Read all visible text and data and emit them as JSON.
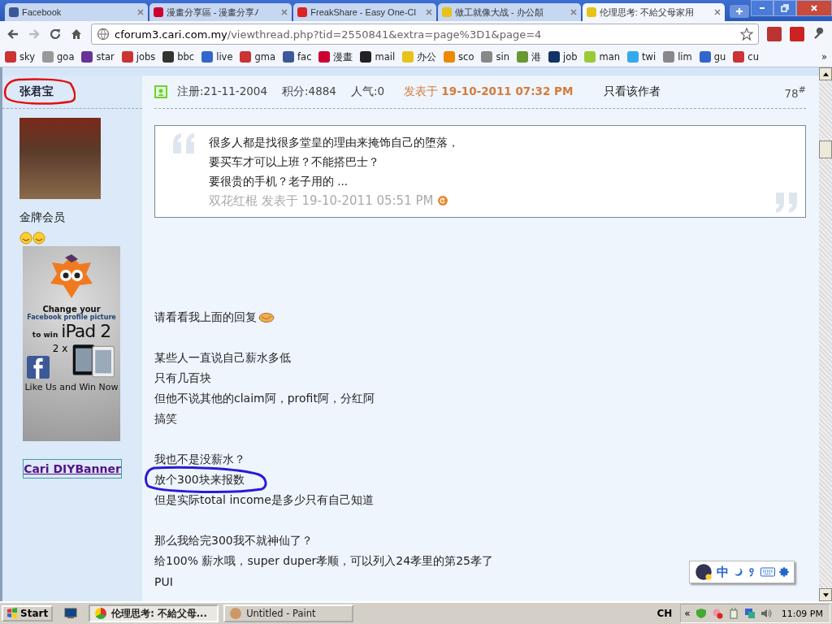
{
  "tabs": [
    {
      "title": "Facebook",
      "selected": false
    },
    {
      "title": "漫畫分享區 - 漫畫分享ﾉ",
      "selected": false
    },
    {
      "title": "FreakShare - Easy One-Cl",
      "selected": false
    },
    {
      "title": "做工就像大战 - 办公顛",
      "selected": false
    },
    {
      "title": "伦理思考: 不給父母家用",
      "selected": true
    }
  ],
  "address": {
    "host": "cforum3.cari.com.my",
    "path": "/viewthread.php?tid=2550841&extra=page%3D1&page=4"
  },
  "bookmarks": [
    "sky",
    "goa",
    "star",
    "jobs",
    "bbc",
    "live",
    "gma",
    "fac",
    "漫畫",
    "mail",
    "办公",
    "sco",
    "sin",
    "港",
    "job",
    "man",
    "twi",
    "lim",
    "gu",
    "cu"
  ],
  "bookmarks_more": "»",
  "author": {
    "name": "张君宝",
    "circled": true,
    "rank": "金牌会员",
    "link": "Cari DIYBanner"
  },
  "ad": {
    "line_1": "Change your",
    "line_2": "Facebook profile picture",
    "line_3": "to win",
    "line_4": "iPad 2",
    "line_5": "2 x",
    "line_6": "Like Us and Win Now"
  },
  "post_header": {
    "registered": "注册:21-11-2004",
    "points": "积分:4884",
    "popularity": "人气:0",
    "posted": "发表于 **19-10-2011 07:32 PM**",
    "author_only": "只看该作者",
    "floor": "78$^{#}$"
  },
  "quote": {
    "lines": [
      "很多人都是找很多堂皇的理由来掩饰自己的堕落，",
      "要买车才可以上班？不能搭巴士？",
      "要很贵的手机？老子用的 ..."
    ],
    "byline": "双花红棍 发表于 19-10-2011 05:51 PM"
  },
  "body": [
    [
      {
        "text": "请看看我上面的回复",
        "emoji": true,
        "circled": false
      }
    ],
    [
      {
        "text": "某些人一直说自己薪水多低",
        "emoji": false,
        "circled": false
      },
      {
        "text": "只有几百块",
        "emoji": false,
        "circled": false
      },
      {
        "text": "但他不说其他的claim阿，profit阿，分红阿",
        "emoji": false,
        "circled": false
      },
      {
        "text": "搞笑",
        "emoji": false,
        "circled": false
      }
    ],
    [
      {
        "text": "我也不是没薪水？",
        "emoji": false,
        "circled": false
      },
      {
        "text": "放个300块来报数",
        "emoji": false,
        "circled": true
      },
      {
        "text": "但是实际total income是多少只有自己知道",
        "emoji": false,
        "circled": false
      }
    ],
    [
      {
        "text": "那么我给完300我不就神仙了？",
        "emoji": false,
        "circled": false
      },
      {
        "text": "给100% 薪水哦，super duper孝顺，可以列入24孝里的第25孝了",
        "emoji": false,
        "circled": false
      },
      {
        "text": "PUI",
        "emoji": false,
        "circled": false
      }
    ]
  ],
  "ime": {
    "mode": "中"
  },
  "taskbar": {
    "start": "Start",
    "tasks": [
      {
        "title": "伦理思考: 不給父母...",
        "selected": true
      },
      {
        "title": "Untitled - Paint",
        "selected": false
      }
    ],
    "language": "CH",
    "tray_expand": "«",
    "clock": "11:09 PM"
  }
}
